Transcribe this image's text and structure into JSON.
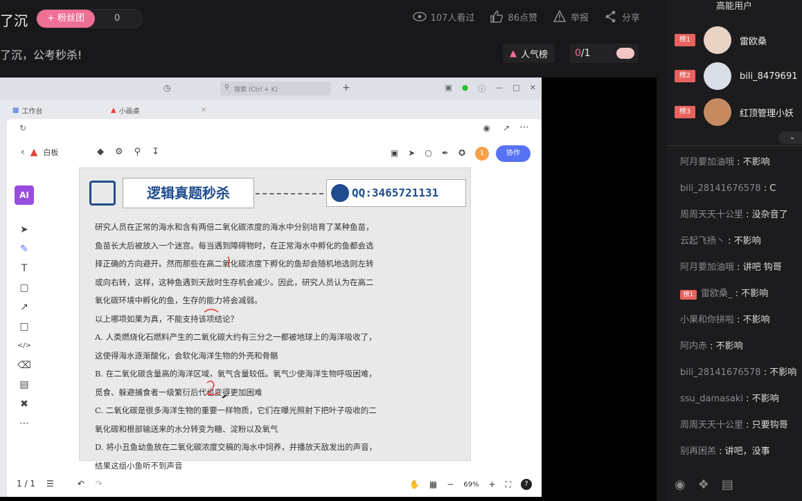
{
  "header": {
    "title": "了沉",
    "fan_button": "+ 粉丝团",
    "fan_count": "0",
    "stats": {
      "views": "107人看过",
      "likes": "86点赞",
      "report": "举报",
      "share": "分享"
    },
    "subtitle": "了沉，公考秒杀!",
    "rank_label": "人气榜",
    "rank_pos": "0",
    "rank_total": "/1"
  },
  "desk": {
    "search": "搜索 (Ctrl + K)",
    "tabs": [
      "工作台",
      "小画桌"
    ],
    "board_label": "白板",
    "badge": "1",
    "collab": "协作",
    "ai": "AI",
    "page": "1 / 1",
    "zoom": "69%",
    "help": "?"
  },
  "sheet": {
    "banner_title": "逻辑真题秒杀",
    "qq": "QQ:3465721131",
    "lines": [
      "研究人员在正常的海水和含有两倍二氧化碳浓度的海水中分别培育了某种鱼苗，",
      "鱼苗长大后被放入一个迷宫。每当遇到障碍物时，在正常海水中孵化的鱼都会选",
      "择正确的方向避开。然而那些在高二氧化碳浓度下孵化的鱼却会随机地选则左转",
      "或向右转，这样，这种鱼遇到天敌时生存机会减少。因此，研究人员认为在高二",
      "氧化碳环境中孵化的鱼，生存的能力将会减弱。",
      "以上哪项如果为真，不能支持该项结论？",
      "A. 人类燃烧化石燃料产生的二氧化碳大约有三分之一都被地球上的海洋吸收了，",
      "这使得海水逐渐酸化，会软化海洋生物的外壳和骨骼",
      "B. 在二氧化碳含量高的海洋区域，氧气含量较低。氧气少使海洋生物呼吸困难，",
      "觅食、躲避捕食者一级繁衍后代也变得更加困难",
      "C. 二氧化碳是很多海洋生物的重要一样物质，它们在曝光照射下把叶子吸收的二",
      "氧化碳和根部输送来的水分转变为糖、淀粉以及氧气",
      "D. 将小丑鱼幼鱼放在二氧化碳浓度交稿的海水中饲养，并播放天敌发出的声音，",
      "结果这组小鱼听不到声音"
    ]
  },
  "panel": {
    "title": "高能用户",
    "fans": [
      {
        "rank": "榜1",
        "name": "雷欧桑"
      },
      {
        "rank": "榜2",
        "name": "bili_8479691"
      },
      {
        "rank": "榜3",
        "name": "红顶管理小妖"
      }
    ],
    "messages": [
      {
        "user": "阿月要加油哦",
        "text": "不影响"
      },
      {
        "user": "bili_28141676578",
        "text": "C"
      },
      {
        "user": "周周天天十公里",
        "text": "没杂音了"
      },
      {
        "user": "云起飞扬丶",
        "text": "不影响"
      },
      {
        "user": "阿月要加油哦",
        "text": "讲吧 钩哥"
      },
      {
        "user": "雷欧桑_",
        "text": "不影响",
        "rank": "榜1"
      },
      {
        "user": "小果和你拼啦",
        "text": "不影响"
      },
      {
        "user": "阿内赤",
        "text": "不影响"
      },
      {
        "user": "bili_28141676578",
        "text": "不影响"
      },
      {
        "user": "ssu_damasaki",
        "text": "不影响"
      },
      {
        "user": "周周天天十公里",
        "text": "只要钩哥"
      },
      {
        "user": "别再困羔",
        "text": "讲吧，没事"
      }
    ]
  }
}
